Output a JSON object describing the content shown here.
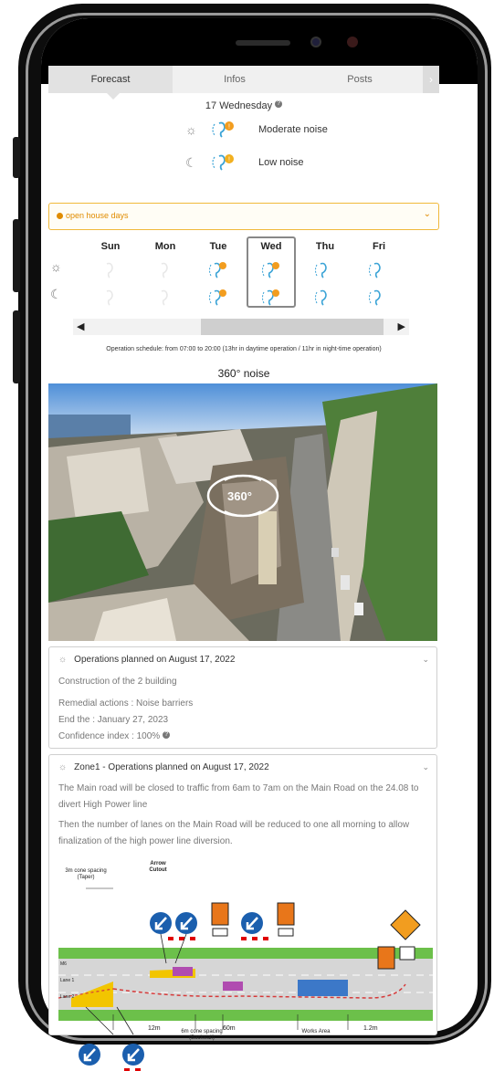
{
  "tabs": [
    {
      "label": "Forecast",
      "active": true
    },
    {
      "label": "Infos",
      "active": false
    },
    {
      "label": "Posts",
      "active": false
    }
  ],
  "forecast": {
    "date": "17 Wednesday",
    "day_noise": "Moderate noise",
    "night_noise": "Low noise"
  },
  "banner": {
    "text": "open house days"
  },
  "week": {
    "days": [
      "Sun",
      "Mon",
      "Tue",
      "Wed",
      "Thu",
      "Fri"
    ],
    "selected": "Wed"
  },
  "schedule": "Operation schedule: from 07:00 to 20:00 (13hr in daytime operation / 11hr in night-time operation)",
  "noise360": {
    "title": "360° noise",
    "badge": "360°"
  },
  "card1": {
    "header": "Operations planned on August 17, 2022",
    "line1": "Construction of the 2 building",
    "line2": "Remedial actions : Noise barriers",
    "line3": "End the : January 27, 2023",
    "line4": "Confidence index : 100%"
  },
  "card2": {
    "header": "Zone1 - Operations planned on August 17, 2022",
    "para1": "The Main road will be closed to traffic from 6am to 7am on the Main Road on the 24.08 to divert High Power line",
    "para2": "Then the number of lanes on the Main Road will be reduced to one all morning to allow finalization of the high power line diversion."
  },
  "diagram": {
    "cone_taper": "3m cone spacing (Taper)",
    "arrow_cutout": "Arrow Cutout",
    "cone_backwall": "6m cone spacing (Backwall)",
    "dist_12m": "12m",
    "dist_60m": "60m",
    "dist_1_2m": "1.2m",
    "works_area": "Works Area",
    "lane_m6": "M6",
    "lane_1": "Lane 1",
    "lane_2": "Lane 2"
  },
  "colors": {
    "banner_orange": "#e08c00",
    "ear_blue": "#3aa3d6",
    "noise_orange": "#f29d1f",
    "grass_green": "#6cc04a",
    "sign_blue": "#1b5fae"
  }
}
